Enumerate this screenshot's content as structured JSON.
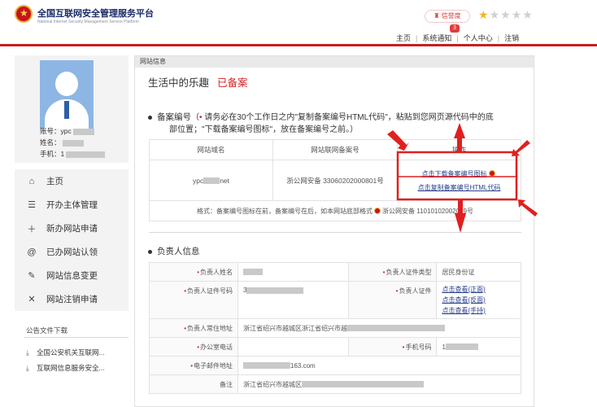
{
  "header": {
    "site_title": "全国互联网安全管理服务平台",
    "site_subtitle": "National Internet Security Management Service Platform",
    "credit_label": "信誉度",
    "stars_filled": 1,
    "stars_total": 5,
    "notification_count": "3",
    "nav": [
      "主页",
      "系统通知",
      "个人中心",
      "注销"
    ]
  },
  "profile": {
    "account_label": "账号：",
    "account_value": "ypc",
    "name_label": "姓名：",
    "phone_label": "手机：",
    "phone_value": "1"
  },
  "sidebar": {
    "items": [
      {
        "label": "主页",
        "icon": "home-icon"
      },
      {
        "label": "开办主体管理",
        "icon": "list-icon"
      },
      {
        "label": "新办网站申请",
        "icon": "plus-icon"
      },
      {
        "label": "已办网站认领",
        "icon": "at-icon"
      },
      {
        "label": "网站信息变更",
        "icon": "edit-icon"
      },
      {
        "label": "网站注销申请",
        "icon": "close-icon"
      }
    ],
    "notice_title": "公告文件下载",
    "notices": [
      "全国公安机关互联网...",
      "互联网信息服务安全..."
    ]
  },
  "panel": {
    "head": "网站信息",
    "site_name": "生活中的乐趣",
    "site_status": "已备案",
    "record_label": "备案编号",
    "record_note_1": "请务必在30个工作日之内\"复制备案编号HTML代码\"，粘贴到您网页源代码中的底",
    "record_note_2": "部位置；\"下载备案编号图标\"，放在备案编号之前。）",
    "record_table": {
      "headers": [
        "网站域名",
        "网站联网备案号",
        "操作"
      ],
      "domain": "ypc",
      "domain_suffix": "net",
      "record_no": "浙公网安备 33060202000801号",
      "action_download": "点击下载备案编号图标",
      "action_copy": "点击复制备案编号HTML代码",
      "format_prefix": "格式：备案编号图标在前，备案编号在后，如本网站底部格式",
      "format_example": "浙公网安备 11010102002019号"
    },
    "person_title": "负责人信息",
    "person": {
      "name_label": "负责人姓名",
      "id_type_label": "负责人证件类型",
      "id_type_value": "居民身份证",
      "id_no_label": "负责人证件号码",
      "id_no_value": "3",
      "cert_label": "负责人证件",
      "cert_links": [
        "点击查看(正面)",
        "点击查看(反面)",
        "点击查看(手持)"
      ],
      "address_label": "负责人常住地址",
      "address_value": "浙江省绍兴市越城区浙江省绍兴市越",
      "office_phone_label": "办公室电话",
      "mobile_label": "手机号码",
      "mobile_value": "1",
      "email_label": "电子邮件地址",
      "email_value": "163.com",
      "remark_label": "备注",
      "remark_value": "浙江省绍兴市越城区"
    }
  },
  "colors": {
    "brand_red": "#c61f1f",
    "highlight_red": "#e02020",
    "link_blue": "#2a3f8a"
  }
}
